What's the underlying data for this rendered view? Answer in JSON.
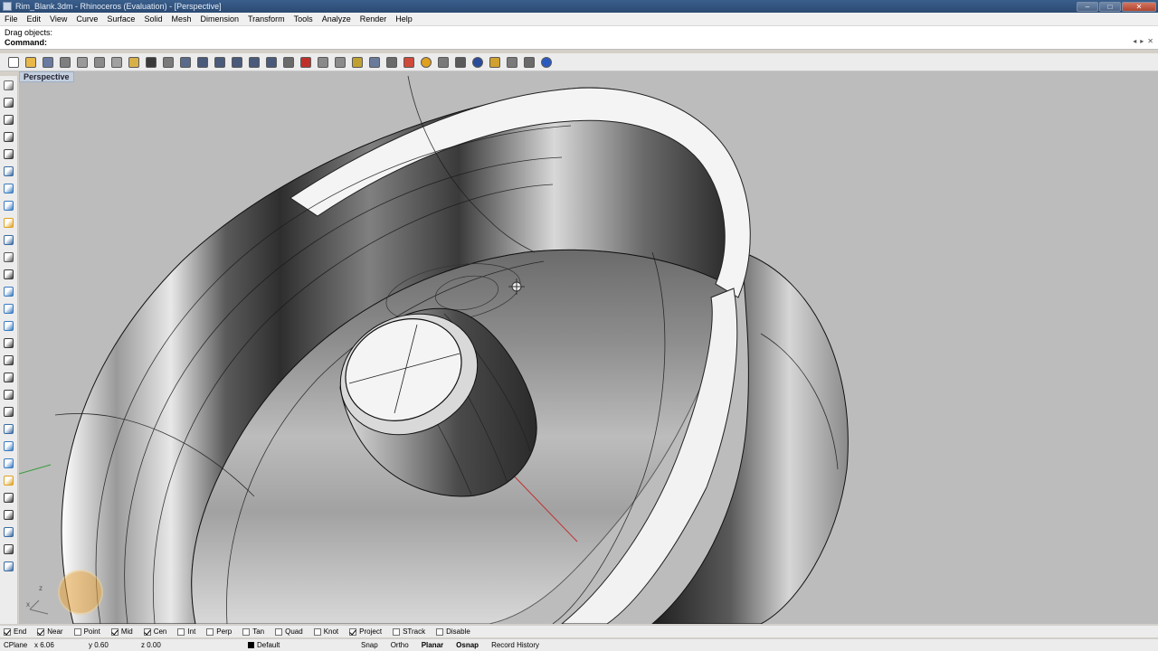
{
  "window": {
    "title": "Rim_Blank.3dm - Rhinoceros (Evaluation) - [Perspective]",
    "controls": [
      "–",
      "□",
      "✕"
    ]
  },
  "menu": {
    "items": [
      "File",
      "Edit",
      "View",
      "Curve",
      "Surface",
      "Solid",
      "Mesh",
      "Dimension",
      "Transform",
      "Tools",
      "Analyze",
      "Render",
      "Help"
    ]
  },
  "command": {
    "history": "Drag objects:",
    "prompt": "Command:",
    "value": ""
  },
  "toolbar": {
    "icons": [
      {
        "name": "new-icon",
        "color": "#ffffff"
      },
      {
        "name": "open-icon",
        "color": "#e8b84a"
      },
      {
        "name": "save-icon",
        "color": "#6a7aa0"
      },
      {
        "name": "print-icon",
        "color": "#7f7f7f"
      },
      {
        "name": "import-icon",
        "color": "#9a9a9a"
      },
      {
        "name": "cut-icon",
        "color": "#8a8a8a"
      },
      {
        "name": "copy-icon",
        "color": "#a0a0a0"
      },
      {
        "name": "paste-icon",
        "color": "#d8b04a"
      },
      {
        "name": "undo-icon",
        "color": "#3a3a3a"
      },
      {
        "name": "pan-icon",
        "color": "#7a7a7a"
      },
      {
        "name": "rotate-view-icon",
        "color": "#5a6a8a"
      },
      {
        "name": "zoom-icon",
        "color": "#4a5a7a"
      },
      {
        "name": "zoom-window-icon",
        "color": "#4a5a7a"
      },
      {
        "name": "zoom-extents-icon",
        "color": "#4a5a7a"
      },
      {
        "name": "zoom-selected-icon",
        "color": "#4a5a7a"
      },
      {
        "name": "undo-view-icon",
        "color": "#4a5a7a"
      },
      {
        "name": "four-viewports-icon",
        "color": "#6a6a6a"
      },
      {
        "name": "select-icon",
        "color": "#c0302a"
      },
      {
        "name": "hide-icon",
        "color": "#8a8a8a"
      },
      {
        "name": "show-icon",
        "color": "#8a8a8a"
      },
      {
        "name": "layer-icon",
        "color": "#c0a030"
      },
      {
        "name": "light-icon",
        "color": "#6a7a9a"
      },
      {
        "name": "lock-icon",
        "color": "#6a6a6a"
      },
      {
        "name": "object-properties-icon",
        "color": "#d04a3a"
      },
      {
        "name": "color-wheel-icon",
        "color": "#e0a020"
      },
      {
        "name": "mesh-icon",
        "color": "#7a7a7a"
      },
      {
        "name": "options-icon",
        "color": "#5a5a5a"
      },
      {
        "name": "render-sphere-icon",
        "color": "#2a4a9a"
      },
      {
        "name": "render-icon",
        "color": "#d0a030"
      },
      {
        "name": "settings-gear-icon",
        "color": "#7a7a7a"
      },
      {
        "name": "grid-snap-icon",
        "color": "#6a6a6a"
      },
      {
        "name": "help-icon",
        "color": "#2a5ac0"
      }
    ]
  },
  "left_tools": {
    "icons": [
      {
        "name": "select-arrow-icon",
        "color": "#6a6a6a"
      },
      {
        "name": "point-icon",
        "color": "#3a3a3a"
      },
      {
        "name": "polyline-icon",
        "color": "#3a3a3a"
      },
      {
        "name": "curve-icon",
        "color": "#3a3a3a"
      },
      {
        "name": "circle-icon",
        "color": "#3a3a3a"
      },
      {
        "name": "surface-icon",
        "color": "#3a6aa0"
      },
      {
        "name": "box-icon",
        "color": "#3a7ac0"
      },
      {
        "name": "cylinder-icon",
        "color": "#3a7ac0"
      },
      {
        "name": "mesh-tool-icon",
        "color": "#e0a020"
      },
      {
        "name": "transform-icon",
        "color": "#3a6aa0"
      },
      {
        "name": "boolean-icon",
        "color": "#5a5a5a"
      },
      {
        "name": "fillet-icon",
        "color": "#3a3a3a"
      },
      {
        "name": "text-icon",
        "color": "#3a7ac0"
      },
      {
        "name": "array-icon",
        "color": "#3a7ac0"
      },
      {
        "name": "solid-tools-icon",
        "color": "#3a7ac0"
      },
      {
        "name": "dot-icon",
        "color": "#3a3a3a"
      },
      {
        "name": "dimension-icon",
        "color": "#3a3a3a"
      },
      {
        "name": "loft-icon",
        "color": "#3a3a3a"
      },
      {
        "name": "rectangle-icon",
        "color": "#3a3a3a"
      },
      {
        "name": "arc-icon",
        "color": "#3a3a3a"
      },
      {
        "name": "sweep-icon",
        "color": "#3a6aa0"
      },
      {
        "name": "revolve-icon",
        "color": "#3a7ac0"
      },
      {
        "name": "extrude-icon",
        "color": "#3a7ac0"
      },
      {
        "name": "pencil-icon",
        "color": "#e0a020"
      },
      {
        "name": "split-icon",
        "color": "#3a3a3a"
      },
      {
        "name": "join-icon",
        "color": "#3a3a3a"
      },
      {
        "name": "explode-icon",
        "color": "#3a6aa0"
      },
      {
        "name": "trim-icon",
        "color": "#3a3a3a"
      },
      {
        "name": "analyze-icon",
        "color": "#3a6aa0"
      }
    ]
  },
  "viewport": {
    "title": "Perspective",
    "axis_z_label": "z",
    "axis_x_label": "x"
  },
  "osnap": {
    "items": [
      {
        "label": "End",
        "checked": true
      },
      {
        "label": "Near",
        "checked": true
      },
      {
        "label": "Point",
        "checked": false
      },
      {
        "label": "Mid",
        "checked": true
      },
      {
        "label": "Cen",
        "checked": true
      },
      {
        "label": "Int",
        "checked": false
      },
      {
        "label": "Perp",
        "checked": false
      },
      {
        "label": "Tan",
        "checked": false
      },
      {
        "label": "Quad",
        "checked": false
      },
      {
        "label": "Knot",
        "checked": false
      },
      {
        "label": "Project",
        "checked": true
      },
      {
        "label": "STrack",
        "checked": false
      },
      {
        "label": "Disable",
        "checked": false
      }
    ]
  },
  "status": {
    "cplane": "CPlane",
    "x": "x 6.06",
    "y": "y 0.60",
    "z": "z 0.00",
    "layer": "Default",
    "snap": "Snap",
    "ortho": "Ortho",
    "planar": "Planar",
    "osnap": "Osnap",
    "record_history": "Record History"
  }
}
